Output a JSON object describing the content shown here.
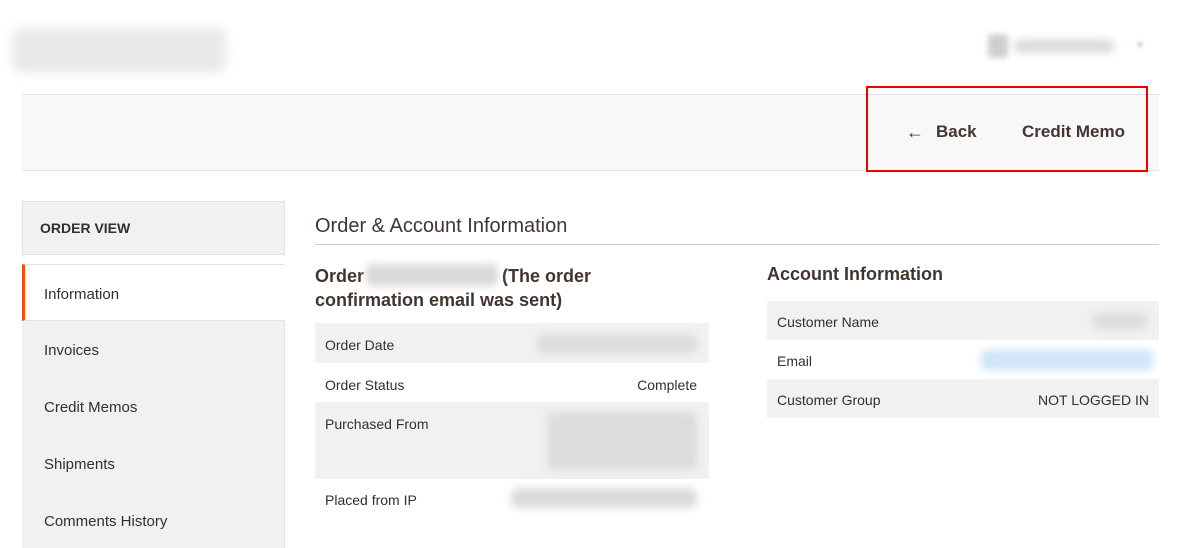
{
  "header": {
    "logo_blurred": true,
    "user_menu": {
      "caret_icon": "chevron-down-icon"
    }
  },
  "page_actions": {
    "back_icon": "arrow-left-icon",
    "back_label": "Back",
    "credit_memo_label": "Credit Memo",
    "highlight_color": "#ee0000"
  },
  "sidebar": {
    "title": "ORDER VIEW",
    "tabs": [
      {
        "label": "Information",
        "active": true
      },
      {
        "label": "Invoices"
      },
      {
        "label": "Credit Memos"
      },
      {
        "label": "Shipments"
      },
      {
        "label": "Comments History"
      }
    ],
    "accent_color": "#eb5202"
  },
  "main": {
    "section_title": "Order & Account Information",
    "order": {
      "title_prefix": "Order",
      "title_suffix": "(The order confirmation email was sent)",
      "rows": [
        {
          "label": "Order Date",
          "value": ""
        },
        {
          "label": "Order Status",
          "value": "Complete"
        },
        {
          "label": "Purchased From",
          "value": ""
        },
        {
          "label": "Placed from IP",
          "value": ""
        }
      ]
    },
    "account": {
      "title": "Account Information",
      "rows": [
        {
          "label": "Customer Name",
          "value": ""
        },
        {
          "label": "Email",
          "value": ""
        },
        {
          "label": "Customer Group",
          "value": "NOT LOGGED IN"
        }
      ]
    }
  }
}
